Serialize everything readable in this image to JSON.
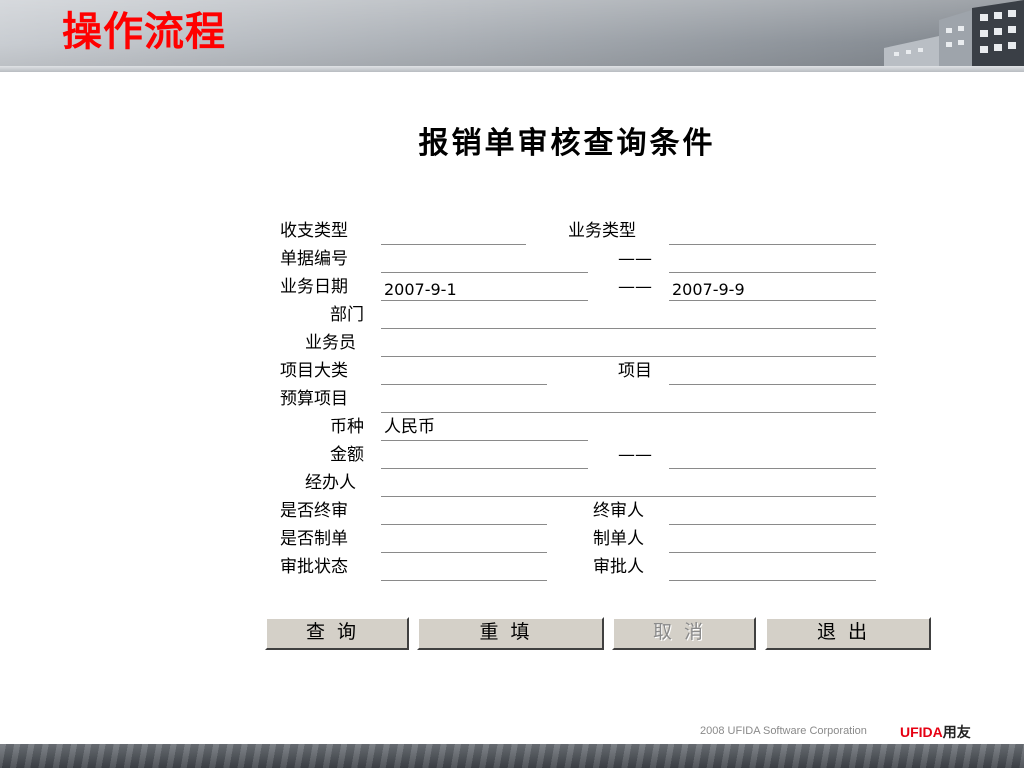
{
  "header": {
    "title": "操作流程"
  },
  "form": {
    "title": "报销单审核查询条件",
    "labels": {
      "income_type": "收支类型",
      "business_type": "业务类型",
      "doc_number": "单据编号",
      "doc_number_to": "——",
      "business_date": "业务日期",
      "business_date_to": "——",
      "department": "部门",
      "salesperson": "业务员",
      "project_category": "项目大类",
      "project": "项目",
      "budget_item": "预算项目",
      "currency": "币种",
      "amount": "金额",
      "amount_to": "——",
      "handler": "经办人",
      "is_final_review": "是否终审",
      "final_reviewer": "终审人",
      "is_doc_made": "是否制单",
      "doc_maker": "制单人",
      "approval_status": "审批状态",
      "approver": "审批人"
    },
    "values": {
      "business_date_from": "2007-9-1",
      "business_date_to": "2007-9-9",
      "currency": "人民币"
    }
  },
  "buttons": {
    "query": "查询",
    "reset": "重填",
    "cancel": "取消",
    "exit": "退出"
  },
  "footer": {
    "copyright": "2008 UFIDA Software Corporation",
    "logo_en": "UFIDA",
    "logo_cn": "用友"
  }
}
